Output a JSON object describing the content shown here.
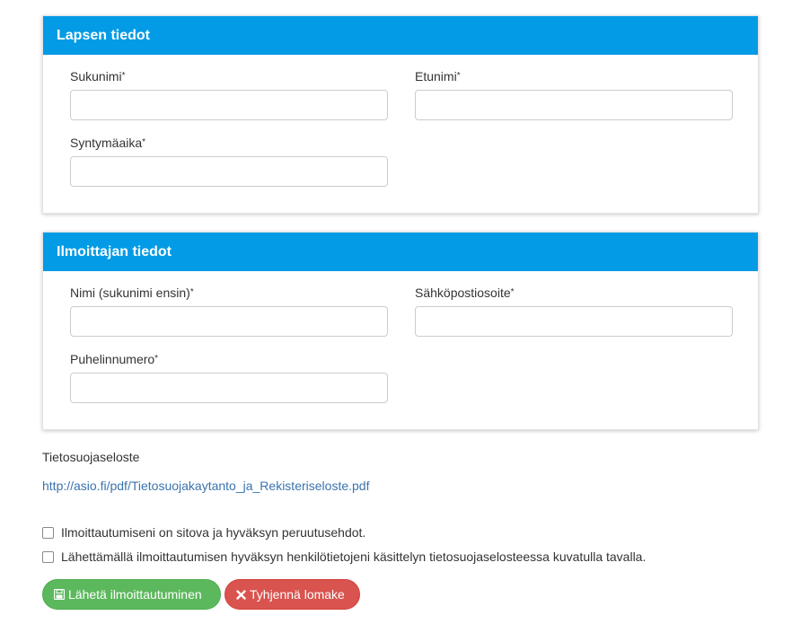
{
  "colors": {
    "panel_header_bg": "#039be5",
    "panel_header_text": "#ffffff",
    "link": "#3b73af",
    "send_button": "#5cb85c",
    "clear_button": "#d9534f"
  },
  "child_panel": {
    "title": "Lapsen tiedot",
    "surname": {
      "label": "Sukunimi",
      "required_mark": "*",
      "value": ""
    },
    "firstname": {
      "label": "Etunimi",
      "required_mark": "*",
      "value": ""
    },
    "birthdate": {
      "label": "Syntymäaika",
      "required_mark": "*",
      "value": ""
    }
  },
  "reporter_panel": {
    "title": "Ilmoittajan tiedot",
    "name": {
      "label": "Nimi (sukunimi ensin)",
      "required_mark": "*",
      "value": ""
    },
    "email": {
      "label": "Sähköpostiosoite",
      "required_mark": "*",
      "value": ""
    },
    "phone": {
      "label": "Puhelinnumero",
      "required_mark": "*",
      "value": ""
    }
  },
  "privacy": {
    "label": "Tietosuojaseloste",
    "link_text": "http://asio.fi/pdf/Tietosuojakaytanto_ja_Rekisteriseloste.pdf"
  },
  "checkboxes": [
    {
      "label": "Ilmoittautumiseni on sitova ja hyväksyn peruutusehdot.",
      "checked": false
    },
    {
      "label": "Lähettämällä ilmoittautumisen hyväksyn henkilötietojeni käsittelyn tietosuojaselosteessa kuvatulla tavalla.",
      "checked": false
    }
  ],
  "buttons": {
    "send": {
      "label": "Lähetä ilmoittautuminen",
      "icon": "save-icon"
    },
    "clear": {
      "label": "Tyhjennä lomake",
      "icon": "close-icon"
    }
  }
}
